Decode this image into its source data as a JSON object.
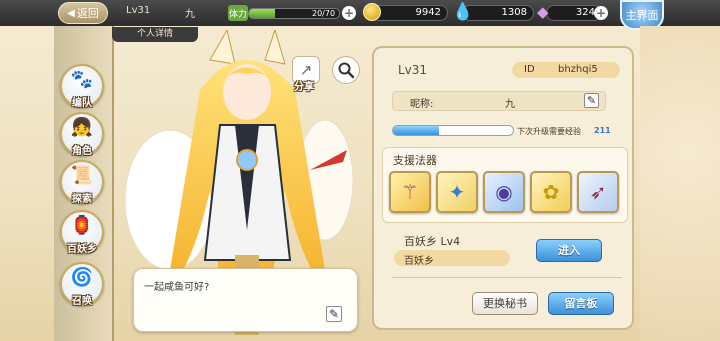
{
  "topbar": {
    "back_label": "返回",
    "level": "Lv31",
    "player_name": "九",
    "stamina_icon_label": "体力",
    "stamina_text": "20/70",
    "stamina_fraction": 0.29,
    "gold": "9942",
    "water": "1308",
    "crystal": "324",
    "main_label": "主界面",
    "icons": [
      "gold-coin-icon",
      "water-drop-icon",
      "crystal-icon",
      "plus-icon"
    ]
  },
  "detail_tab": "个人详情",
  "sidebar": {
    "items": [
      {
        "label": "编队",
        "icon": "team-icon"
      },
      {
        "label": "角色",
        "icon": "character-icon"
      },
      {
        "label": "探索",
        "icon": "explore-icon"
      },
      {
        "label": "百妖乡",
        "icon": "village-icon"
      },
      {
        "label": "召唤",
        "icon": "summon-icon"
      }
    ]
  },
  "character": {
    "share_label": "分享",
    "speech": "一起咸鱼可好?"
  },
  "profile": {
    "level": "Lv31",
    "id_label": "ID",
    "id_value": "bhzhqi5",
    "nickname_label": "昵称:",
    "nickname_value": "九",
    "exp_fraction": 0.38,
    "exp_label": "下次升级需要经验",
    "exp_value": "211",
    "support_title": "支援法器",
    "support_items": [
      "staff-icon",
      "trident-icon",
      "orb-icon",
      "flower-icon",
      "bow-icon"
    ],
    "realm_title": "百妖乡  Lv4",
    "realm_value": "百妖乡",
    "enter_label": "进入",
    "secret_label": "更换秘书",
    "board_label": "留言板"
  }
}
